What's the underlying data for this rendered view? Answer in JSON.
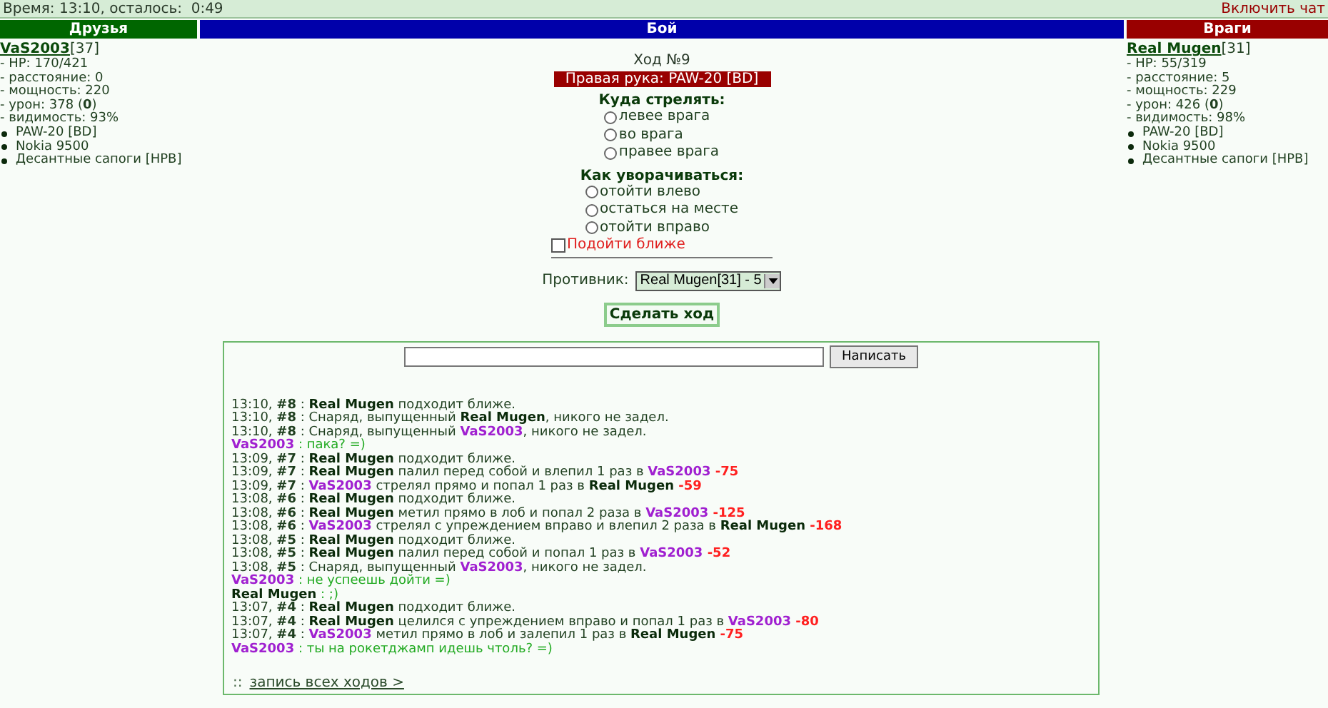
{
  "top_bar": {
    "timer": "Время: 13:10, осталось:  0:49",
    "chat_link": "Включить чат"
  },
  "headers": {
    "friends": "Друзья",
    "battle": "Бой",
    "enemies": "Враги"
  },
  "friends": [
    {
      "name": "VaS2003",
      "level": "[37]",
      "stats": [
        "- HP: 170/421",
        "- расстояние: 0",
        "- мощность: 220",
        "- урон: 378 (**0**)",
        "- видимость: 93%"
      ],
      "items": [
        "PAW-20 [BD]",
        "Nokia 9500",
        "Десантные сапоги [HPB]"
      ]
    }
  ],
  "enemies": [
    {
      "name": "Real Mugen",
      "level": "[31]",
      "stats": [
        "- HP: 55/319",
        "- расстояние: 5",
        "- мощность: 229",
        "- урон: 426 (**0**)",
        "- видимость: 98%"
      ],
      "items": [
        "PAW-20 [BD]",
        "Nokia 9500",
        "Десантные сапоги [HPB]"
      ]
    }
  ],
  "battle": {
    "turn": "Ход №9",
    "weapon": "Правая рука: PAW-20 [BD]",
    "shoot": {
      "title": "Куда стрелять:",
      "options": [
        {
          "label": "левее врага",
          "selected": false
        },
        {
          "label": "во врага",
          "selected": false
        },
        {
          "label": "правее врага",
          "selected": false
        }
      ]
    },
    "dodge": {
      "title": "Как уворачиваться:",
      "options": [
        {
          "label": "отойти влево",
          "selected": false
        },
        {
          "label": "остаться на месте",
          "selected": false
        },
        {
          "label": "отойти вправо",
          "selected": false
        }
      ]
    },
    "approach": {
      "label": "Подойти ближе",
      "checked": false
    },
    "opponent": {
      "label": "Противник:",
      "value": "Real Mugen[31] - 5"
    },
    "submit": "Сделать ход"
  },
  "chat": {
    "send": "Написать",
    "log": [
      {
        "segments": [
          {
            "kind": "text",
            "text": "13:10, **#8** : "
          },
          {
            "kind": "enemy",
            "text": "Real Mugen"
          },
          {
            "kind": "text",
            "text": " подходит ближе."
          }
        ]
      },
      {
        "segments": [
          {
            "kind": "text",
            "text": "13:10, **#8** : Снаряд, выпущенный "
          },
          {
            "kind": "enemy",
            "text": "Real Mugen"
          },
          {
            "kind": "text",
            "text": ", никого не задел."
          }
        ]
      },
      {
        "segments": [
          {
            "kind": "text",
            "text": "13:10, **#8** : Снаряд, выпущенный "
          },
          {
            "kind": "ally",
            "text": "VaS2003"
          },
          {
            "kind": "text",
            "text": ", никого не задел."
          }
        ]
      },
      {
        "segments": [
          {
            "kind": "ally",
            "text": "VaS2003"
          },
          {
            "kind": "chat",
            "text": " : пака? =)"
          }
        ]
      },
      {
        "segments": [
          {
            "kind": "text",
            "text": "13:09, **#7** : "
          },
          {
            "kind": "enemy",
            "text": "Real Mugen"
          },
          {
            "kind": "text",
            "text": " подходит ближе."
          }
        ]
      },
      {
        "segments": [
          {
            "kind": "text",
            "text": "13:09, **#7** : "
          },
          {
            "kind": "enemy",
            "text": "Real Mugen"
          },
          {
            "kind": "text",
            "text": " палил перед собой и влепил 1 раз в "
          },
          {
            "kind": "ally",
            "text": "VaS2003"
          },
          {
            "kind": "damage",
            "text": " -75"
          }
        ]
      },
      {
        "segments": [
          {
            "kind": "text",
            "text": "13:09, **#7** : "
          },
          {
            "kind": "ally",
            "text": "VaS2003"
          },
          {
            "kind": "text",
            "text": " стрелял прямо и попал 1 раз в "
          },
          {
            "kind": "enemy",
            "text": "Real Mugen"
          },
          {
            "kind": "damage",
            "text": " -59"
          }
        ]
      },
      {
        "segments": [
          {
            "kind": "text",
            "text": "13:08, **#6** : "
          },
          {
            "kind": "enemy",
            "text": "Real Mugen"
          },
          {
            "kind": "text",
            "text": " подходит ближе."
          }
        ]
      },
      {
        "segments": [
          {
            "kind": "text",
            "text": "13:08, **#6** : "
          },
          {
            "kind": "enemy",
            "text": "Real Mugen"
          },
          {
            "kind": "text",
            "text": " метил прямо в лоб и попал 2 раза в "
          },
          {
            "kind": "ally",
            "text": "VaS2003"
          },
          {
            "kind": "damage",
            "text": " -125"
          }
        ]
      },
      {
        "segments": [
          {
            "kind": "text",
            "text": "13:08, **#6** : "
          },
          {
            "kind": "ally",
            "text": "VaS2003"
          },
          {
            "kind": "text",
            "text": " стрелял с упреждением вправо и влепил 2 раза в "
          },
          {
            "kind": "enemy",
            "text": "Real Mugen"
          },
          {
            "kind": "damage",
            "text": " -168"
          }
        ]
      },
      {
        "segments": [
          {
            "kind": "text",
            "text": "13:08, **#5** : "
          },
          {
            "kind": "enemy",
            "text": "Real Mugen"
          },
          {
            "kind": "text",
            "text": " подходит ближе."
          }
        ]
      },
      {
        "segments": [
          {
            "kind": "text",
            "text": "13:08, **#5** : "
          },
          {
            "kind": "enemy",
            "text": "Real Mugen"
          },
          {
            "kind": "text",
            "text": " палил перед собой и попал 1 раз в "
          },
          {
            "kind": "ally",
            "text": "VaS2003"
          },
          {
            "kind": "damage",
            "text": " -52"
          }
        ]
      },
      {
        "segments": [
          {
            "kind": "text",
            "text": "13:08, **#5** : Снаряд, выпущенный "
          },
          {
            "kind": "ally",
            "text": "VaS2003"
          },
          {
            "kind": "text",
            "text": ", никого не задел."
          }
        ]
      },
      {
        "segments": [
          {
            "kind": "ally",
            "text": "VaS2003"
          },
          {
            "kind": "chat",
            "text": " : не успеешь дойти =)"
          }
        ]
      },
      {
        "segments": [
          {
            "kind": "enemy",
            "text": "Real Mugen"
          },
          {
            "kind": "chat",
            "text": " : ;)"
          }
        ]
      },
      {
        "segments": [
          {
            "kind": "text",
            "text": "13:07, **#4** : "
          },
          {
            "kind": "enemy",
            "text": "Real Mugen"
          },
          {
            "kind": "text",
            "text": " подходит ближе."
          }
        ]
      },
      {
        "segments": [
          {
            "kind": "text",
            "text": "13:07, **#4** : "
          },
          {
            "kind": "enemy",
            "text": "Real Mugen"
          },
          {
            "kind": "text",
            "text": " целился с упреждением вправо и попал 1 раз в "
          },
          {
            "kind": "ally",
            "text": "VaS2003"
          },
          {
            "kind": "damage",
            "text": " -80"
          }
        ]
      },
      {
        "segments": [
          {
            "kind": "text",
            "text": "13:07, **#4** : "
          },
          {
            "kind": "ally",
            "text": "VaS2003"
          },
          {
            "kind": "text",
            "text": " метил прямо в лоб и залепил 1 раз в "
          },
          {
            "kind": "enemy",
            "text": "Real Mugen"
          },
          {
            "kind": "damage",
            "text": " -75"
          }
        ]
      },
      {
        "segments": [
          {
            "kind": "ally",
            "text": "VaS2003"
          },
          {
            "kind": "chat",
            "text": " : ты на рокетджамп идешь чтоль? =)"
          }
        ]
      }
    ],
    "history_prefix": "::",
    "history_link": "запись всех ходов >"
  }
}
